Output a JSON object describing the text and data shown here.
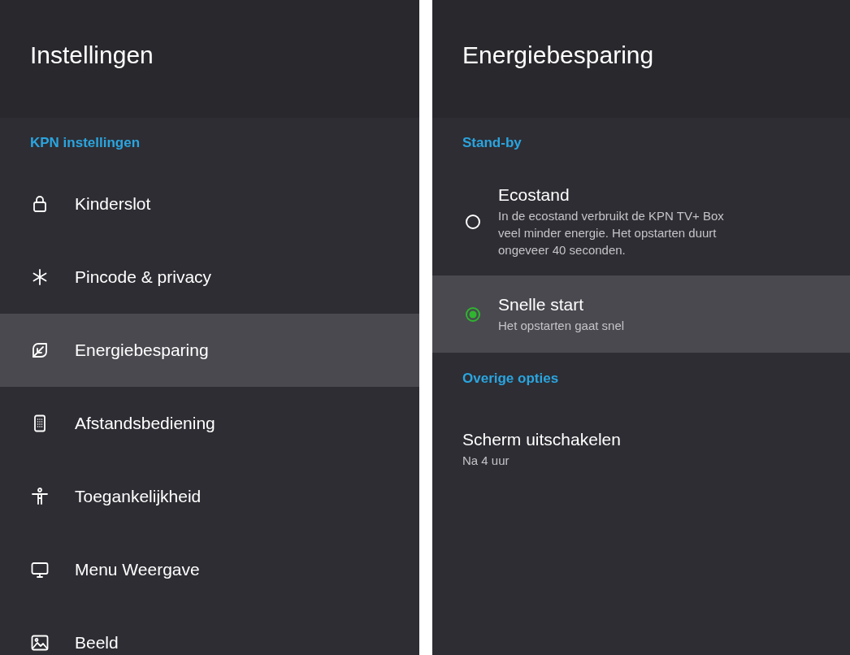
{
  "settings_panel": {
    "title": "Instellingen",
    "section_header": "KPN instellingen",
    "items": [
      {
        "label": "Kinderslot",
        "selected": false
      },
      {
        "label": "Pincode & privacy",
        "selected": false
      },
      {
        "label": "Energiebesparing",
        "selected": true
      },
      {
        "label": "Afstandsbediening",
        "selected": false
      },
      {
        "label": "Toegankelijkheid",
        "selected": false
      },
      {
        "label": "Menu Weergave",
        "selected": false
      },
      {
        "label": "Beeld",
        "selected": false
      }
    ]
  },
  "detail_panel": {
    "title": "Energiebesparing",
    "sections": [
      {
        "header": "Stand-by",
        "items": [
          {
            "kind": "radio",
            "title": "Ecostand",
            "description": "In de ecostand verbruikt de KPN TV+ Box veel minder energie. Het opstarten duurt ongeveer 40 seconden.",
            "checked": false,
            "focused": false
          },
          {
            "kind": "radio",
            "title": "Snelle start",
            "description": "Het opstarten gaat snel",
            "checked": true,
            "focused": true
          }
        ]
      },
      {
        "header": "Overige opties",
        "items": [
          {
            "kind": "setting",
            "title": "Scherm uitschakelen",
            "description": "Na 4 uur",
            "focused": false
          }
        ]
      }
    ]
  }
}
